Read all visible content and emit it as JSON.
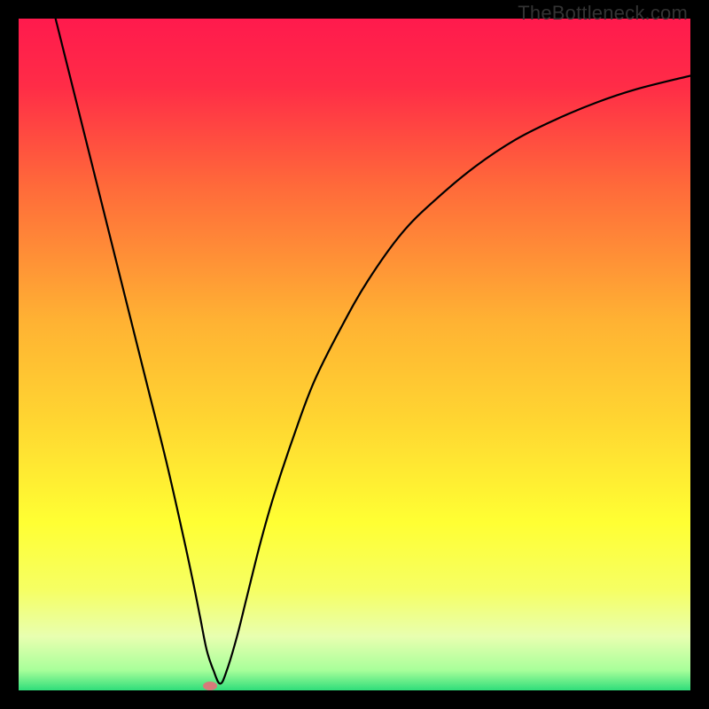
{
  "watermark": "TheBottleneck.com",
  "chart_data": {
    "type": "line",
    "title": "",
    "xlabel": "",
    "ylabel": "",
    "xlim": [
      0,
      100
    ],
    "ylim": [
      0,
      100
    ],
    "background_gradient": {
      "stops": [
        {
          "offset": 0.0,
          "color": "#ff1a4d"
        },
        {
          "offset": 0.1,
          "color": "#ff2c47"
        },
        {
          "offset": 0.25,
          "color": "#ff6a3a"
        },
        {
          "offset": 0.45,
          "color": "#ffb233"
        },
        {
          "offset": 0.6,
          "color": "#ffd631"
        },
        {
          "offset": 0.75,
          "color": "#ffff33"
        },
        {
          "offset": 0.85,
          "color": "#f6ff63"
        },
        {
          "offset": 0.92,
          "color": "#e8ffb0"
        },
        {
          "offset": 0.97,
          "color": "#a8ff9a"
        },
        {
          "offset": 1.0,
          "color": "#2fdd7a"
        }
      ]
    },
    "series": [
      {
        "name": "curve",
        "x": [
          5.5,
          7,
          10,
          13,
          16,
          19,
          22,
          24.5,
          26,
          27,
          28,
          29,
          30,
          31,
          32.5,
          34,
          36,
          38,
          41,
          44,
          48,
          52,
          57,
          62,
          68,
          74,
          80,
          86,
          92,
          100
        ],
        "y": [
          100,
          94,
          82,
          70,
          58,
          46,
          34,
          23,
          16,
          11,
          6,
          3,
          1,
          3,
          8,
          14,
          22,
          29,
          38,
          46,
          54,
          61,
          68,
          73,
          78,
          82,
          85,
          87.5,
          89.5,
          91.5
        ]
      }
    ],
    "marker": {
      "x": 28.5,
      "y": 0.6,
      "color": "#d67a7a"
    }
  }
}
